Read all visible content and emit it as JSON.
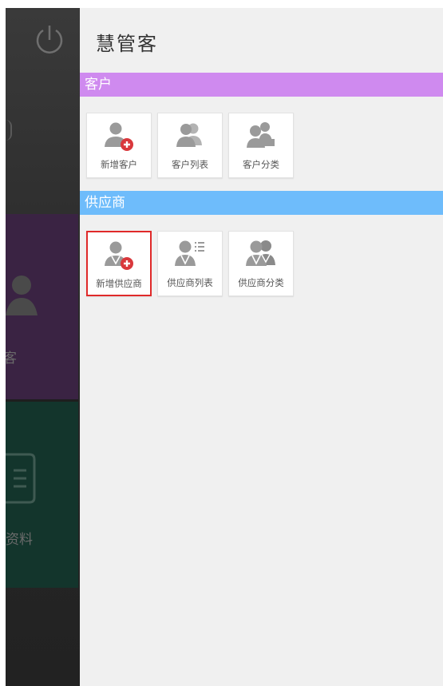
{
  "background": {
    "tiles": {
      "customer_partial_label": "户客",
      "material_partial_label": "资料"
    }
  },
  "drawer": {
    "title": "慧管客",
    "sections": [
      {
        "label": "客户",
        "color": "#cf8aef",
        "items": [
          {
            "label": "新增客户",
            "icon": "add-customer-icon"
          },
          {
            "label": "客户列表",
            "icon": "customer-list-icon"
          },
          {
            "label": "客户分类",
            "icon": "customer-category-icon"
          }
        ]
      },
      {
        "label": "供应商",
        "color": "#6ebcfb",
        "items": [
          {
            "label": "新增供应商",
            "icon": "add-supplier-icon",
            "selected": true
          },
          {
            "label": "供应商列表",
            "icon": "supplier-list-icon"
          },
          {
            "label": "供应商分类",
            "icon": "supplier-category-icon"
          }
        ]
      }
    ]
  },
  "colors": {
    "selected_border": "#e02a2a",
    "badge_red": "#d9383c",
    "icon_gray": "#9a9a9a"
  }
}
